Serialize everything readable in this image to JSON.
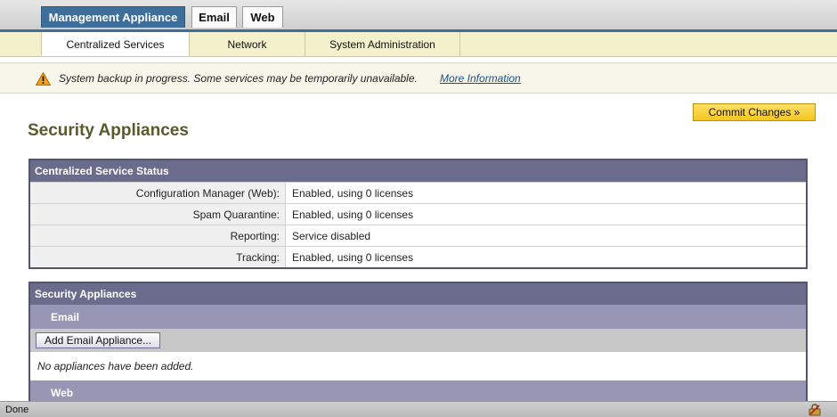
{
  "tabs": [
    {
      "label": "Management Appliance"
    },
    {
      "label": "Email"
    },
    {
      "label": "Web"
    }
  ],
  "subnav": [
    {
      "label": "Centralized Services"
    },
    {
      "label": "Network"
    },
    {
      "label": "System Administration"
    }
  ],
  "notice": {
    "icon": "warning-icon",
    "text": "System backup in progress. Some services may be temporarily unavailable.",
    "link": "More Information"
  },
  "commit_label": "Commit Changes »",
  "page_title": "Security Appliances",
  "status_panel": {
    "title": "Centralized Service Status",
    "rows": [
      {
        "label": "Configuration Manager (Web):",
        "value": "Enabled, using 0 licenses"
      },
      {
        "label": "Spam Quarantine:",
        "value": "Enabled, using 0 licenses"
      },
      {
        "label": "Reporting:",
        "value": "Service disabled"
      },
      {
        "label": "Tracking:",
        "value": "Enabled, using 0 licenses"
      }
    ]
  },
  "appliances_panel": {
    "title": "Security Appliances",
    "email": {
      "heading": "Email",
      "add_button": "Add Email Appliance...",
      "empty": "No appliances have been added."
    },
    "web": {
      "heading": "Web"
    }
  },
  "statusbar": {
    "text": "Done"
  },
  "colors": {
    "accent": "#3e6f9b",
    "panel_header": "#6b6b8c",
    "sub_header": "#9797b5",
    "commit": "#f4c61f"
  }
}
